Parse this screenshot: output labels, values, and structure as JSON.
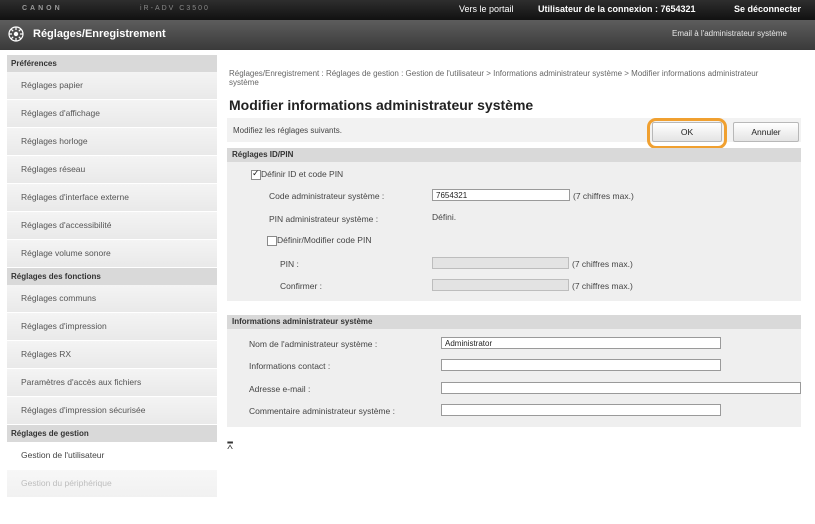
{
  "topbar": {
    "brand": "CANON",
    "brand_model": "iR-ADV C3500",
    "portal_link": "Vers le portail",
    "user_label": "Utilisateur de la connexion :  7654321",
    "logout": "Se déconnecter"
  },
  "titlebar": {
    "logo_icon": "settings-registration-icon",
    "title": "Réglages/Enregistrement",
    "mail_link": "Email à l'administrateur système"
  },
  "sidebar": {
    "sections": [
      {
        "header": "Préférences",
        "items": [
          {
            "label": "Réglages papier"
          },
          {
            "label": "Réglages d'affichage"
          },
          {
            "label": "Réglages horloge"
          },
          {
            "label": "Réglages réseau"
          },
          {
            "label": "Réglages d'interface externe"
          },
          {
            "label": "Réglages d'accessibilité"
          },
          {
            "label": "Réglage volume sonore"
          }
        ]
      },
      {
        "header": "Réglages des fonctions",
        "items": [
          {
            "label": "Réglages communs"
          },
          {
            "label": "Réglages d'impression"
          },
          {
            "label": "Réglages RX"
          },
          {
            "label": "Paramètres d'accès aux fichiers"
          },
          {
            "label": "Réglages d'impression sécurisée"
          }
        ]
      },
      {
        "header": "Réglages de gestion",
        "items": [
          {
            "label": "Gestion de l'utilisateur",
            "active": true
          },
          {
            "label": "Gestion du périphérique",
            "faded": true
          }
        ]
      }
    ]
  },
  "main": {
    "breadcrumb": "Réglages/Enregistrement : Réglages de gestion : Gestion de l'utilisateur > Informations administrateur système > Modifier informations administrateur système",
    "page_title": "Modifier informations administrateur système",
    "instruction": "Modifiez les réglages suivants.",
    "ok_label": "OK",
    "cancel_label": "Annuler",
    "highlight_color": "#f0a030",
    "id_pin_section": {
      "header": "Réglages ID/PIN",
      "define_id_pin": {
        "label": "Définir ID et code PIN",
        "checked": true
      },
      "admin_code": {
        "label": "Code administrateur système :",
        "value": "7654321",
        "hint": "(7 chiffres max.)"
      },
      "admin_pin": {
        "label": "PIN administrateur système :",
        "value": "Défini."
      },
      "set_change_pin": {
        "label": "Définir/Modifier code PIN",
        "checked": false
      },
      "pin": {
        "label": "PIN :",
        "value": "",
        "hint": "(7 chiffres max.)"
      },
      "confirm": {
        "label": "Confirmer :",
        "value": "",
        "hint": "(7 chiffres max.)"
      }
    },
    "admin_info_section": {
      "header": "Informations administrateur système",
      "admin_name": {
        "label": "Nom de l'administrateur système :",
        "value": "Administrator"
      },
      "contact_info": {
        "label": "Informations contact :",
        "value": ""
      },
      "email": {
        "label": "Adresse e-mail :",
        "value": ""
      },
      "admin_comment": {
        "label": "Commentaire administrateur système :",
        "value": ""
      }
    },
    "top_icon": "back-to-top-icon",
    "top_glyph": "⩞"
  }
}
